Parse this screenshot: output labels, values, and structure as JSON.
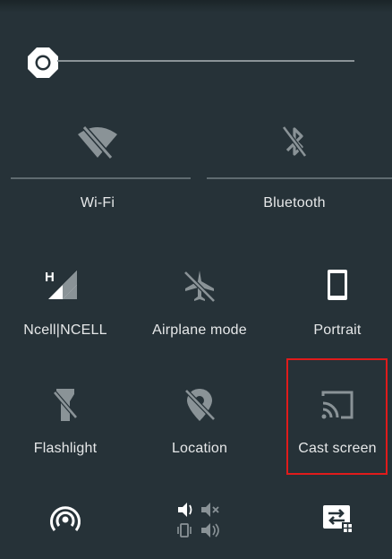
{
  "quick_settings": {
    "wifi": {
      "label": "Wi-Fi",
      "state": "off"
    },
    "bluetooth": {
      "label": "Bluetooth",
      "state": "off"
    },
    "mobile": {
      "label": "Ncell|NCELL",
      "network_type": "H"
    },
    "airplane": {
      "label": "Airplane mode",
      "state": "off"
    },
    "rotation": {
      "label": "Portrait"
    },
    "flashlight": {
      "label": "Flashlight",
      "state": "off"
    },
    "location": {
      "label": "Location",
      "state": "off"
    },
    "cast": {
      "label": "Cast screen"
    }
  },
  "icons": {
    "brightness": "brightness-sun-icon",
    "wifi": "wifi-off-icon",
    "bluetooth": "bluetooth-off-icon",
    "mobile": "cellular-signal-icon",
    "airplane": "airplane-off-icon",
    "rotation": "phone-portrait-icon",
    "flashlight": "flashlight-off-icon",
    "location": "location-off-icon",
    "cast": "cast-icon",
    "hotspot": "hotspot-icon",
    "sound": "sound-mode-icon",
    "data_saver": "screen-swap-icon"
  },
  "colors": {
    "background": "#263238",
    "icon_on": "#ffffff",
    "icon_off": "#8a9397",
    "highlight": "#e01b1b"
  }
}
